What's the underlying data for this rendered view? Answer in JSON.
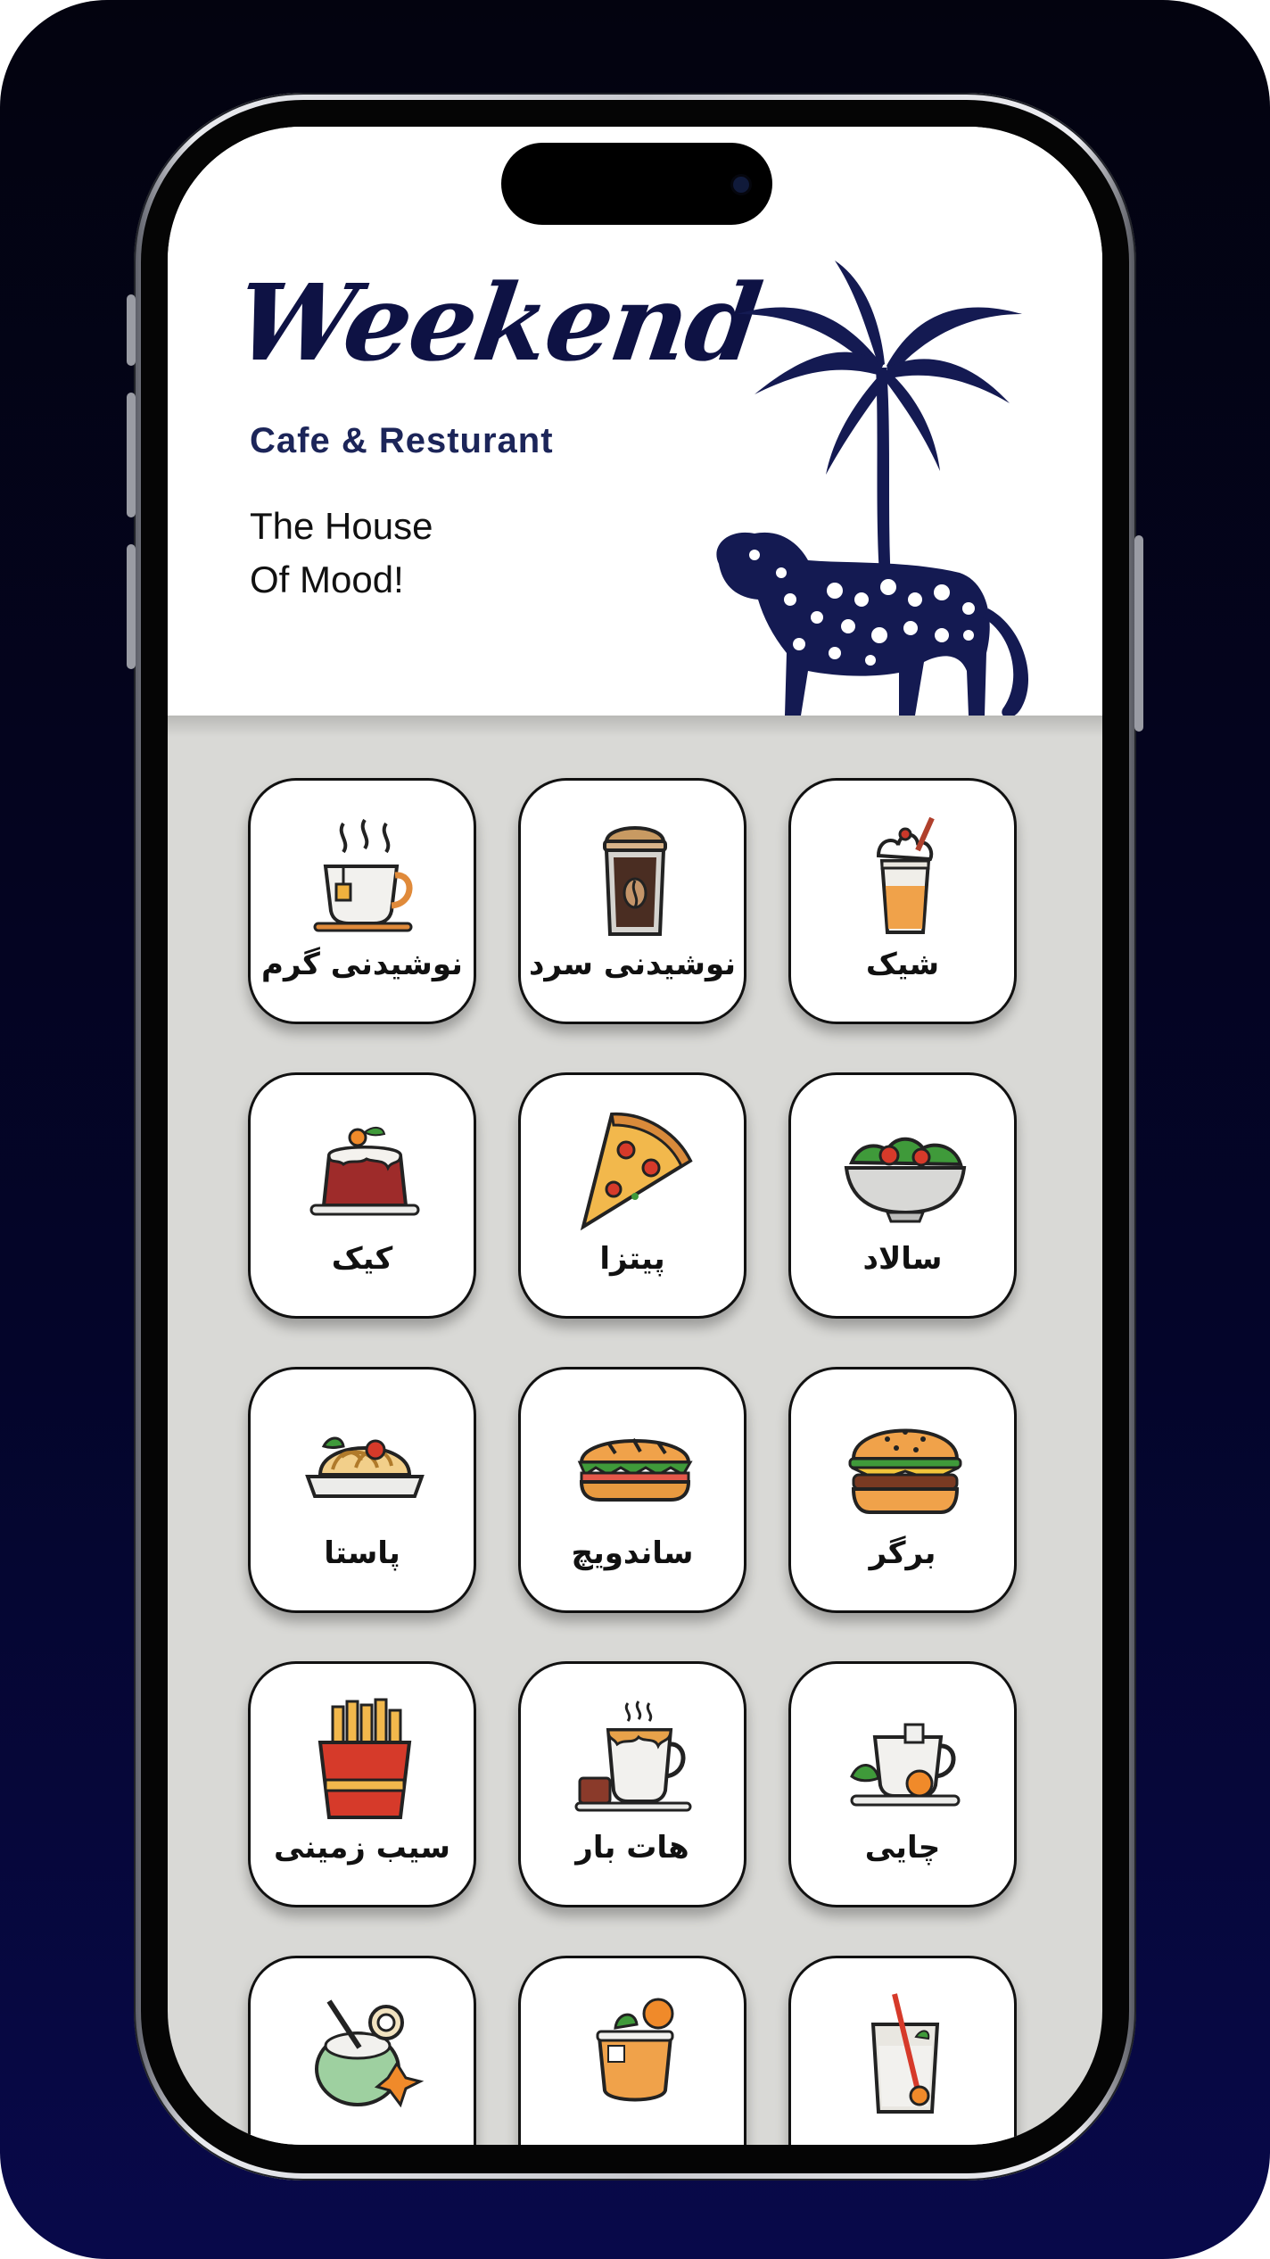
{
  "header": {
    "brand": "Weekend",
    "subtitle": "Cafe & Resturant",
    "tagline_line1": "The House",
    "tagline_line2": "Of Mood!"
  },
  "menu": {
    "items": [
      {
        "label": "شیک",
        "icon": "milkshake-icon"
      },
      {
        "label": "نوشیدنی سرد",
        "icon": "iced-coffee-icon"
      },
      {
        "label": "نوشیدنی گرم",
        "icon": "hot-tea-cup-icon"
      },
      {
        "label": "سالاد",
        "icon": "salad-bowl-icon"
      },
      {
        "label": "پیتزا",
        "icon": "pizza-slice-icon"
      },
      {
        "label": "کیک",
        "icon": "pudding-cake-icon"
      },
      {
        "label": "برگر",
        "icon": "burger-icon"
      },
      {
        "label": "ساندویچ",
        "icon": "sandwich-icon"
      },
      {
        "label": "پاستا",
        "icon": "pasta-icon"
      },
      {
        "label": "چایی",
        "icon": "tea-icon"
      },
      {
        "label": "هات بار",
        "icon": "hot-chocolate-icon"
      },
      {
        "label": "سیب زمینی",
        "icon": "fries-icon"
      },
      {
        "label": "",
        "icon": "iced-drink-icon"
      },
      {
        "label": "",
        "icon": "cocktail-icon"
      },
      {
        "label": "",
        "icon": "coconut-drink-icon"
      }
    ]
  },
  "colors": {
    "navy": "#0e1244",
    "background": "#d9d9d6",
    "card": "#ffffff"
  }
}
